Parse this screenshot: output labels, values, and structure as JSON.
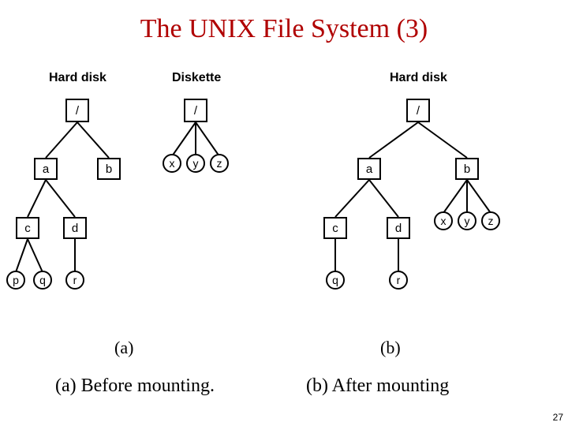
{
  "title": "The UNIX File System (3)",
  "headers": {
    "hd_left": "Hard disk",
    "diskette": "Diskette",
    "hd_right": "Hard disk"
  },
  "nodes": {
    "root": "/",
    "a": "a",
    "b": "b",
    "c": "c",
    "d": "d",
    "p": "p",
    "q": "q",
    "r": "r",
    "x": "x",
    "y": "y",
    "z": "z"
  },
  "sublabels": {
    "a": "(a)",
    "b": "(b)"
  },
  "captions": {
    "left": "(a) Before mounting.",
    "right": "(b) After mounting"
  },
  "page": "27"
}
